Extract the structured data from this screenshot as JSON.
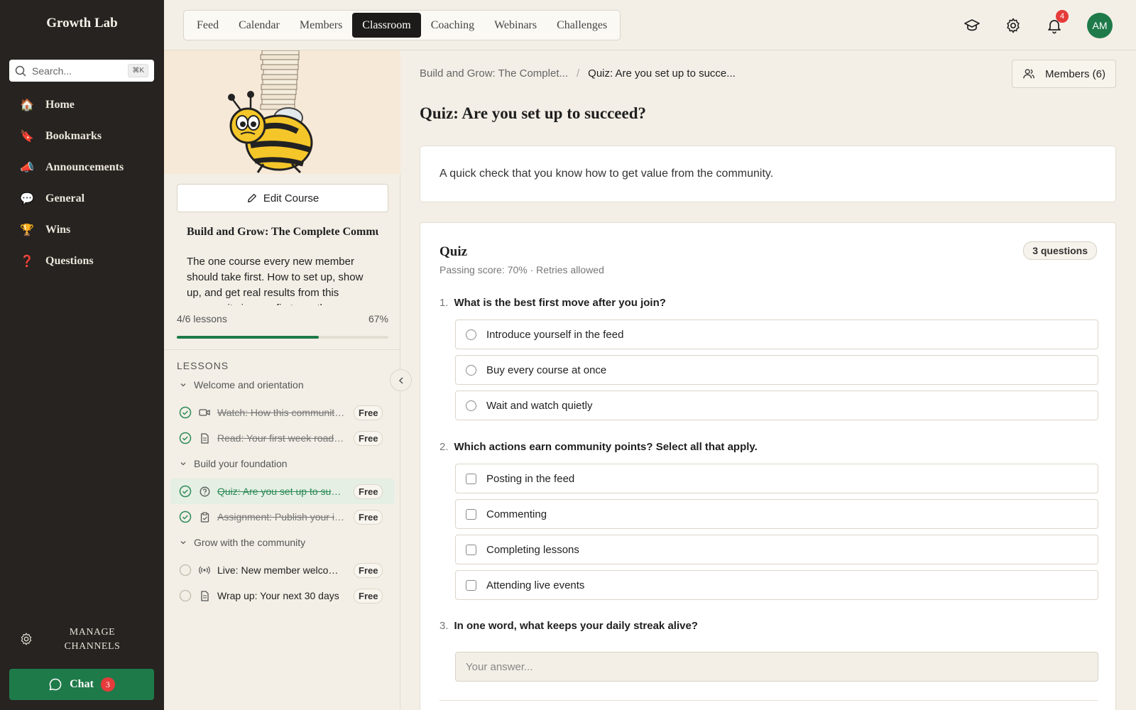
{
  "sidebar": {
    "brand": "Growth Lab",
    "search": {
      "placeholder": "Search...",
      "shortcut": "⌘K"
    },
    "items": [
      {
        "emoji": "🏠",
        "label": "Home"
      },
      {
        "emoji": "🔖",
        "label": "Bookmarks"
      },
      {
        "emoji": "📣",
        "label": "Announcements"
      },
      {
        "emoji": "💬",
        "label": "General"
      },
      {
        "emoji": "🏆",
        "label": "Wins"
      },
      {
        "emoji": "❓",
        "label": "Questions"
      }
    ],
    "manage_line1": "MANAGE",
    "manage_line2": "CHANNELS",
    "chat_label": "Chat",
    "chat_count": "3"
  },
  "topbar": {
    "tabs": [
      "Feed",
      "Calendar",
      "Members",
      "Classroom",
      "Coaching",
      "Webinars",
      "Challenges"
    ],
    "active_tab": "Classroom",
    "notif_count": "4",
    "avatar_initials": "AM"
  },
  "course": {
    "edit_label": "Edit Course",
    "title": "Build and Grow: The Complete Community Playbook",
    "description": "The one course every new member should take first. How to set up, show up, and get real results from this community in your first month.",
    "progress_text": "4/6 lessons",
    "progress_pct_text": "67%",
    "progress_fraction": 0.67,
    "lessons_heading": "LESSONS",
    "sections": [
      {
        "title": "Welcome and orientation",
        "lessons": [
          {
            "type": "video",
            "title": "Watch: How this community works",
            "badge": "Free",
            "done": true
          },
          {
            "type": "doc",
            "title": "Read: Your first week roadmap",
            "badge": "Free",
            "done": true
          }
        ]
      },
      {
        "title": "Build your foundation",
        "lessons": [
          {
            "type": "quiz",
            "title": "Quiz: Are you set up to succeed?",
            "badge": "Free",
            "done": true,
            "active": true
          },
          {
            "type": "assignment",
            "title": "Assignment: Publish your intro",
            "badge": "Free",
            "done": true
          }
        ]
      },
      {
        "title": "Grow with the community",
        "lessons": [
          {
            "type": "live",
            "title": "Live: New member welcome call",
            "badge": "Free",
            "done": false
          },
          {
            "type": "doc",
            "title": "Wrap up: Your next 30 days",
            "badge": "Free",
            "done": false
          }
        ]
      }
    ]
  },
  "main": {
    "breadcrumb_parent": "Build and Grow: The Complet...",
    "breadcrumb_current": "Quiz: Are you set up to succe...",
    "members_label": "Members (6)",
    "title": "Quiz: Are you set up to succeed?",
    "intro": "A quick check that you know how to get value from the community.",
    "quiz": {
      "heading": "Quiz",
      "count_label": "3 questions",
      "passing": "Passing score: 70% · Retries allowed",
      "q1": {
        "num": "1.",
        "text": "What is the best first move after you join?",
        "options": [
          "Introduce yourself in the feed",
          "Buy every course at once",
          "Wait and watch quietly"
        ]
      },
      "q2": {
        "num": "2.",
        "text": "Which actions earn community points? Select all that apply.",
        "options": [
          "Posting in the feed",
          "Commenting",
          "Completing lessons",
          "Attending live events"
        ]
      },
      "q3": {
        "num": "3.",
        "text": "In one word, what keeps your daily streak alive?",
        "placeholder": "Your answer..."
      }
    }
  },
  "colors": {
    "sidebar_bg": "#262320",
    "accent_green": "#1f7a4a",
    "badge_red": "#e53b3b",
    "page_bg": "#f3efe6"
  }
}
